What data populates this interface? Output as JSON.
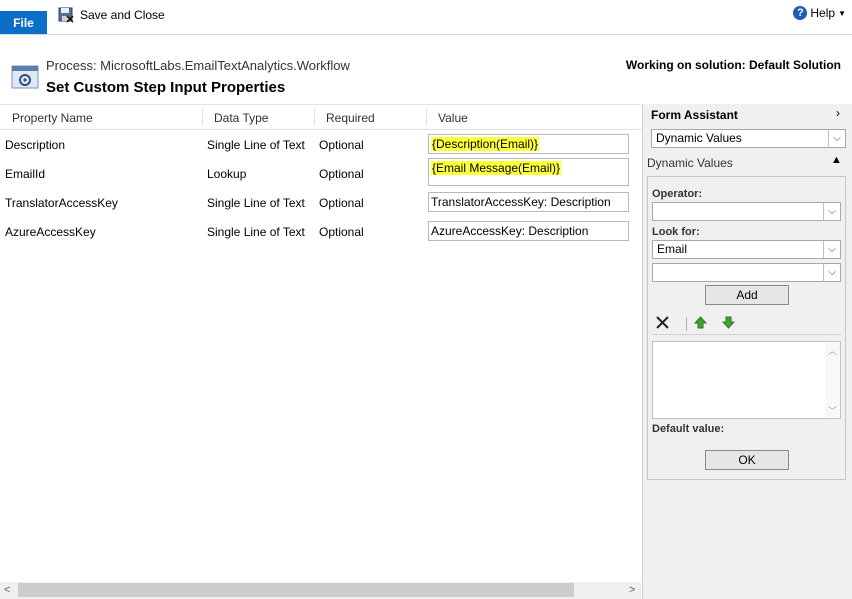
{
  "ribbon": {
    "file_label": "File",
    "save_close_label": "Save and Close",
    "help_label": "Help"
  },
  "header": {
    "process_line": "Process: MicrosoftLabs.EmailTextAnalytics.Workflow",
    "title": "Set Custom Step Input Properties",
    "solution": "Working on solution: Default Solution"
  },
  "grid": {
    "columns": [
      "Property Name",
      "Data Type",
      "Required",
      "Value"
    ],
    "rows": [
      {
        "name": "Description",
        "type": "Single Line of Text",
        "required": "Optional",
        "value": "{Description(Email)}",
        "highlight": true
      },
      {
        "name": "EmailId",
        "type": "Lookup",
        "required": "Optional",
        "value": "{Email Message(Email)}",
        "highlight": true
      },
      {
        "name": "TranslatorAccessKey",
        "type": "Single Line of Text",
        "required": "Optional",
        "value": "TranslatorAccessKey: Description",
        "highlight": false
      },
      {
        "name": "AzureAccessKey",
        "type": "Single Line of Text",
        "required": "Optional",
        "value": "AzureAccessKey: Description",
        "highlight": false
      }
    ]
  },
  "form_assistant": {
    "title": "Form Assistant",
    "mode_select": "Dynamic Values",
    "section_label": "Dynamic Values",
    "operator_label": "Operator:",
    "operator_value": "",
    "look_for_label": "Look for:",
    "look_for_value": "Email",
    "second_select_value": "",
    "add_label": "Add",
    "default_value_label": "Default value:",
    "ok_label": "OK"
  },
  "colors": {
    "accent": "#0b6fc7",
    "highlight": "#ffff3a"
  }
}
